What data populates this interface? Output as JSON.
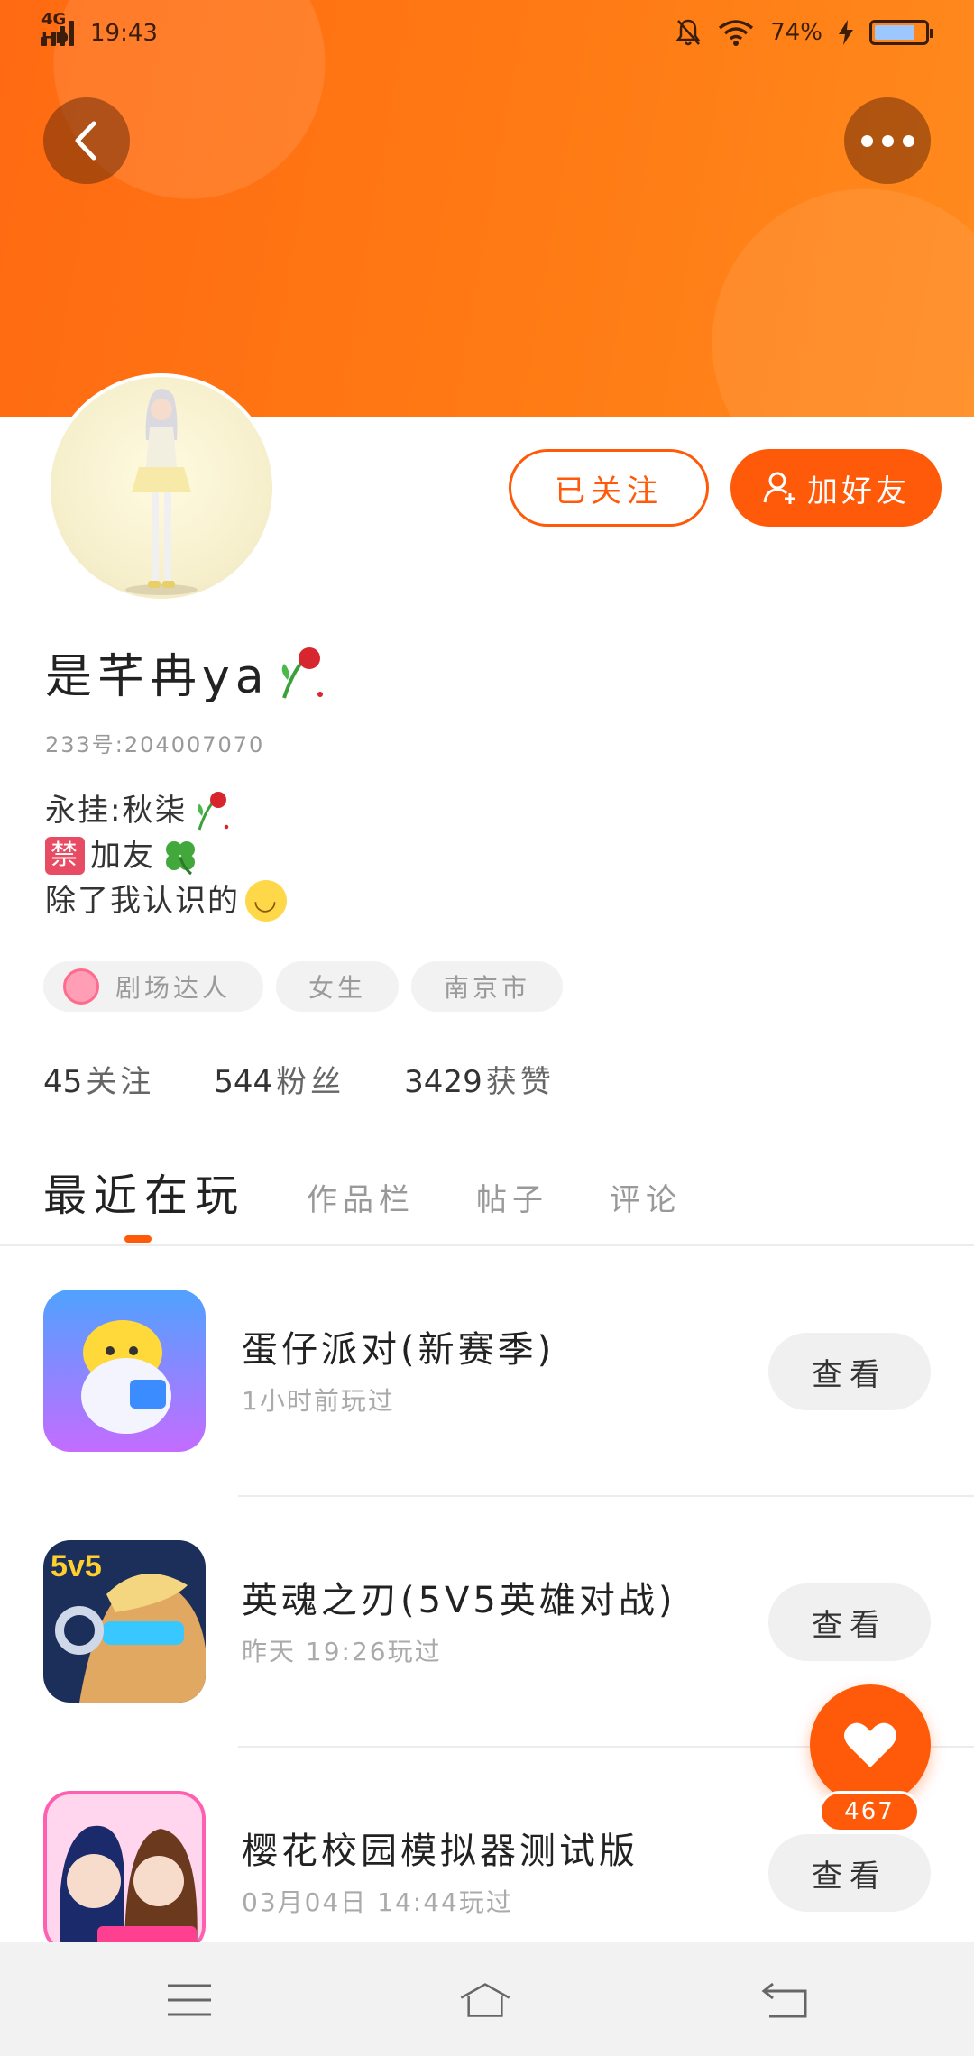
{
  "status_bar": {
    "network": "4G HD",
    "time": "19:43",
    "battery_percent": "74%",
    "battery_level": 0.74
  },
  "header": {
    "back_icon": "chevron-left-icon",
    "more_icon": "more-dots-icon",
    "color": "#ff7a14"
  },
  "profile": {
    "name": "是芊冉ya",
    "id_label": "233号:204007070",
    "followed_label": "已关注",
    "add_friend_label": "加好友",
    "bio": {
      "line1": "永挂:秋柒",
      "line2_badge": "禁",
      "line2_text": "加友",
      "line3": "除了我认识的"
    },
    "tags": [
      "剧场达人",
      "女生",
      "南京市"
    ],
    "stats": [
      {
        "num": "45",
        "label": "关注"
      },
      {
        "num": "544",
        "label": "粉丝"
      },
      {
        "num": "3429",
        "label": "获赞"
      }
    ]
  },
  "tabs": [
    "最近在玩",
    "作品栏",
    "帖子",
    "评论"
  ],
  "games": [
    {
      "title": "蛋仔派对(新赛季)",
      "subtitle": "1小时前玩过",
      "action": "查看"
    },
    {
      "title": "英魂之刃(5V5英雄对战)",
      "subtitle": "昨天 19:26玩过",
      "action": "查看"
    },
    {
      "title": "樱花校园模拟器测试版",
      "subtitle": "03月04日 14:44玩过",
      "action": "查看"
    }
  ],
  "like": {
    "count": "467",
    "icon": "heart-icon"
  },
  "colors": {
    "accent": "#ff5a0a",
    "badge": "#e84b64"
  }
}
